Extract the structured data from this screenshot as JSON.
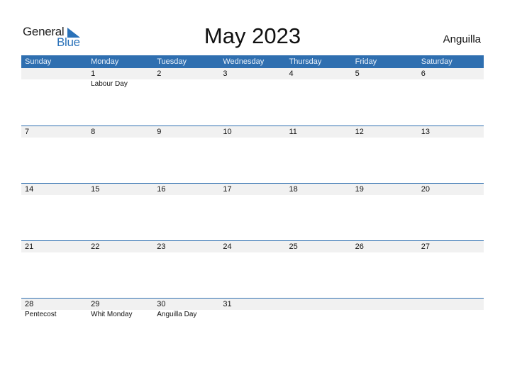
{
  "logo": {
    "text_general": "General",
    "text_blue": "Blue"
  },
  "title": "May 2023",
  "country": "Anguilla",
  "weekdays": [
    "Sunday",
    "Monday",
    "Tuesday",
    "Wednesday",
    "Thursday",
    "Friday",
    "Saturday"
  ],
  "weeks": [
    {
      "days": [
        "",
        "1",
        "2",
        "3",
        "4",
        "5",
        "6"
      ],
      "events": [
        "",
        "Labour Day",
        "",
        "",
        "",
        "",
        ""
      ]
    },
    {
      "days": [
        "7",
        "8",
        "9",
        "10",
        "11",
        "12",
        "13"
      ],
      "events": [
        "",
        "",
        "",
        "",
        "",
        "",
        ""
      ]
    },
    {
      "days": [
        "14",
        "15",
        "16",
        "17",
        "18",
        "19",
        "20"
      ],
      "events": [
        "",
        "",
        "",
        "",
        "",
        "",
        ""
      ]
    },
    {
      "days": [
        "21",
        "22",
        "23",
        "24",
        "25",
        "26",
        "27"
      ],
      "events": [
        "",
        "",
        "",
        "",
        "",
        "",
        ""
      ]
    },
    {
      "days": [
        "28",
        "29",
        "30",
        "31",
        "",
        "",
        ""
      ],
      "events": [
        "Pentecost",
        "Whit Monday",
        "Anguilla Day",
        "",
        "",
        "",
        ""
      ]
    }
  ],
  "colors": {
    "header": "#2f6fb0",
    "brand_blue": "#2a72b9",
    "row_shade": "#f1f1f1"
  }
}
